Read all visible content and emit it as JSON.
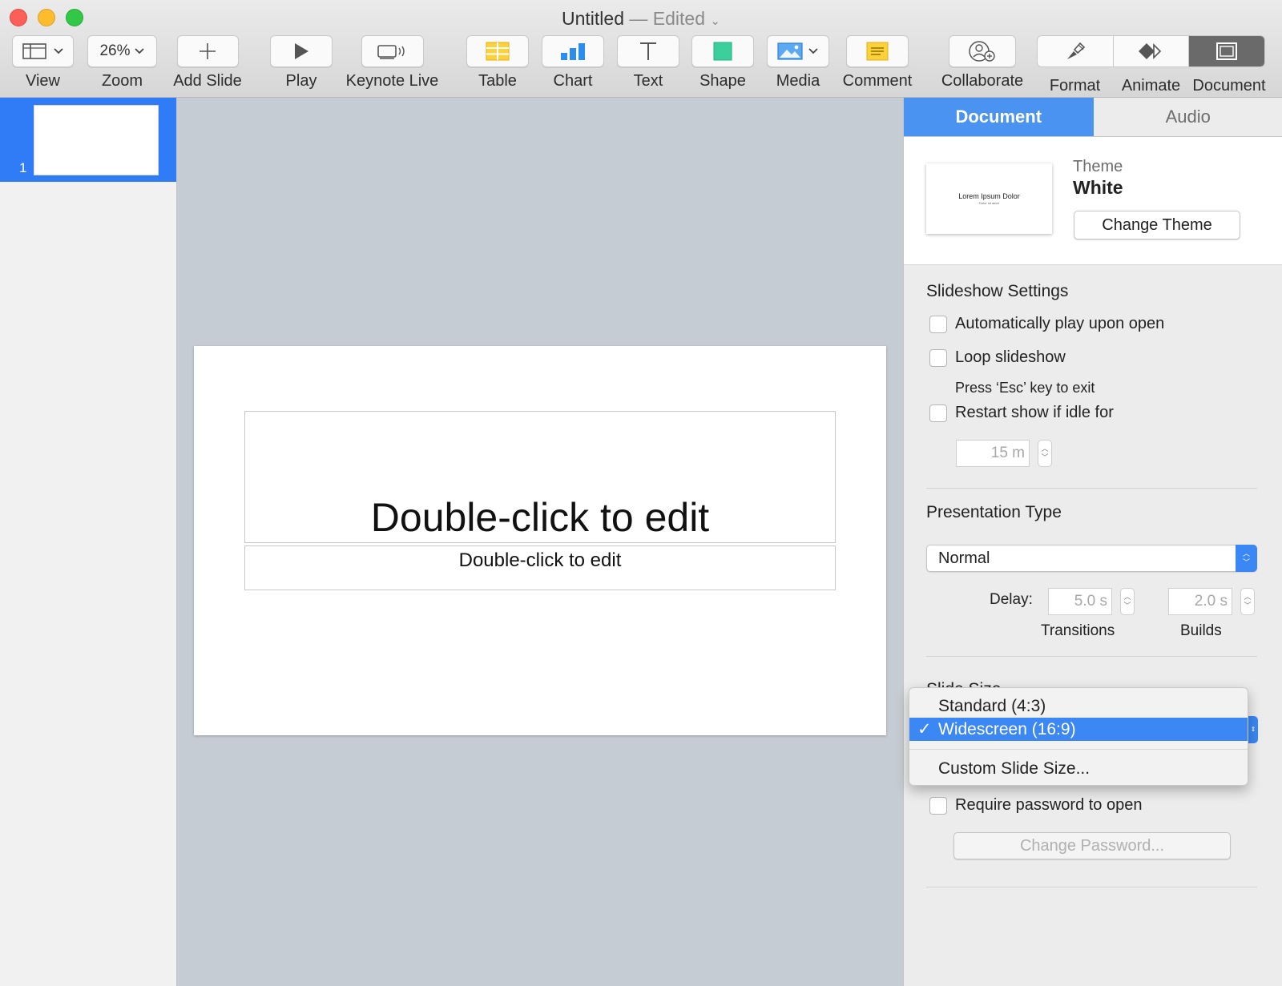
{
  "window": {
    "title": "Untitled",
    "separator": "—",
    "status": "Edited"
  },
  "toolbar": {
    "view_label": "View",
    "zoom_value": "26%",
    "zoom_label": "Zoom",
    "add_slide_label": "Add Slide",
    "play_label": "Play",
    "keynote_live_label": "Keynote Live",
    "table_label": "Table",
    "chart_label": "Chart",
    "text_label": "Text",
    "shape_label": "Shape",
    "media_label": "Media",
    "comment_label": "Comment",
    "collaborate_label": "Collaborate",
    "format_label": "Format",
    "animate_label": "Animate",
    "document_label": "Document"
  },
  "navigator": {
    "slides": [
      {
        "number": "1",
        "selected": true
      }
    ]
  },
  "slide": {
    "title_placeholder": "Double-click to edit",
    "subtitle_placeholder": "Double-click to edit"
  },
  "inspector": {
    "tabs": [
      {
        "label": "Document",
        "active": true
      },
      {
        "label": "Audio",
        "active": false
      }
    ],
    "theme": {
      "kicker": "Theme",
      "name": "White",
      "thumb_title": "Lorem Ipsum Dolor",
      "thumb_subtitle": "Dolor sit amet",
      "change_button": "Change Theme"
    },
    "slideshow": {
      "heading": "Slideshow Settings",
      "auto_play": "Automatically play upon open",
      "loop": "Loop slideshow",
      "loop_hint": "Press ‘Esc’ key to exit",
      "restart": "Restart show if idle for",
      "idle_value": "15 m"
    },
    "presentation": {
      "heading": "Presentation Type",
      "type_value": "Normal",
      "delay_label": "Delay:",
      "transitions_value": "5.0 s",
      "transitions_label": "Transitions",
      "builds_value": "2.0 s",
      "builds_label": "Builds"
    },
    "slide_size": {
      "heading": "Slide Size"
    },
    "password": {
      "require": "Require password to open",
      "change_button": "Change Password..."
    }
  },
  "slide_size_menu": {
    "items": [
      {
        "label": "Standard (4:3)",
        "selected": false
      },
      {
        "label": "Widescreen (16:9)",
        "selected": true
      },
      {
        "label": "Custom Slide Size...",
        "selected": false
      }
    ],
    "check_glyph": "✓"
  },
  "colors": {
    "accent": "#3b87f3",
    "canvas": "#c6ccd3",
    "traffic_red": "#fc5f57",
    "traffic_yellow": "#fdbc2e",
    "traffic_green": "#33c748"
  }
}
